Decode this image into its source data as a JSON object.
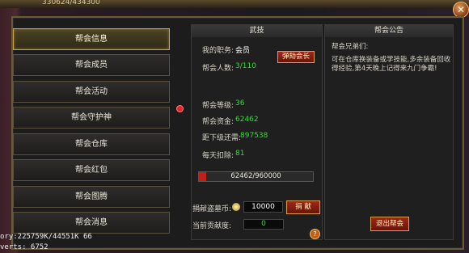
{
  "hud": {
    "hp_readout": "330624/434300"
  },
  "close_icon": "close-icon",
  "sidebar": {
    "items": [
      {
        "label": "帮会信息",
        "active": true
      },
      {
        "label": "帮会成员",
        "active": false
      },
      {
        "label": "帮会活动",
        "active": false
      },
      {
        "label": "帮会守护神",
        "active": false
      },
      {
        "label": "帮会仓库",
        "active": false
      },
      {
        "label": "帮会红包",
        "active": false
      },
      {
        "label": "帮会图腾",
        "active": false
      },
      {
        "label": "帮会消息",
        "active": false
      }
    ]
  },
  "info": {
    "header": "武技",
    "position_label": "我的职务:",
    "position_value": "会员",
    "impeach_button": "弹劾会长",
    "members_label": "帮会人数:",
    "members_value": "3/110",
    "level_label": "帮会等级:",
    "level_value": "36",
    "funds_label": "帮会资金:",
    "funds_value": "62462",
    "next_label": "距下级还需:",
    "next_value": "897538",
    "daily_label": "每天扣除:",
    "daily_value": "81",
    "progress_text": "62462/960000",
    "progress_fraction": 0.065,
    "donate_label": "捐献盗墓币:",
    "donate_value": "10000",
    "donate_button": "捐 献",
    "contrib_label": "当前贡献度:",
    "contrib_value": "0",
    "help_icon": "?"
  },
  "notice": {
    "header": "帮会公告",
    "greeting": "帮会兄弟们:",
    "body": "可在仓库换装备或学技能,多余装备回收得经验,第4天晚上记得来九门争霸!",
    "leave_button": "退出帮会"
  },
  "console": {
    "line1": "ory:225759K/44551K 66",
    "line2": "verts: 6752"
  },
  "colors": {
    "accent_gold": "#c9a54a",
    "value_green": "#33dd33",
    "button_red": "#a02818"
  }
}
